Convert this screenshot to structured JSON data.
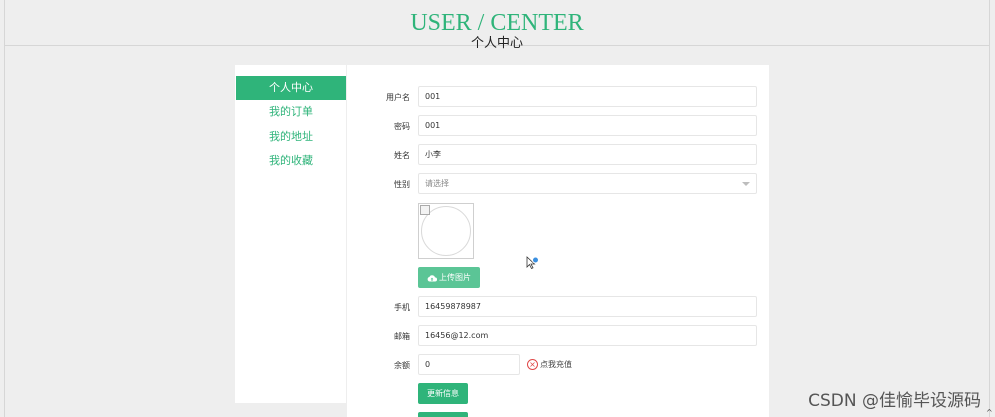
{
  "header": {
    "title_en": "USER / CENTER",
    "title_cn": "个人中心"
  },
  "sidebar": {
    "items": [
      {
        "label": "个人中心",
        "active": true
      },
      {
        "label": "我的订单",
        "active": false
      },
      {
        "label": "我的地址",
        "active": false
      },
      {
        "label": "我的收藏",
        "active": false
      }
    ]
  },
  "form": {
    "username": {
      "label": "用户名",
      "value": "001"
    },
    "password": {
      "label": "密码",
      "value": "001"
    },
    "name": {
      "label": "姓名",
      "value": "小李"
    },
    "gender": {
      "label": "性别",
      "placeholder": "请选择"
    },
    "upload_label": "上传图片",
    "phone": {
      "label": "手机",
      "value": "16459878987"
    },
    "email": {
      "label": "邮箱",
      "value": "16456@12.com"
    },
    "balance": {
      "label": "余额",
      "value": "0"
    },
    "recharge_label": "点我充值",
    "update_label": "更新信息"
  },
  "watermark": "CSDN @佳愉毕设源码",
  "colors": {
    "accent": "#2fb47a",
    "danger": "#e04848"
  }
}
